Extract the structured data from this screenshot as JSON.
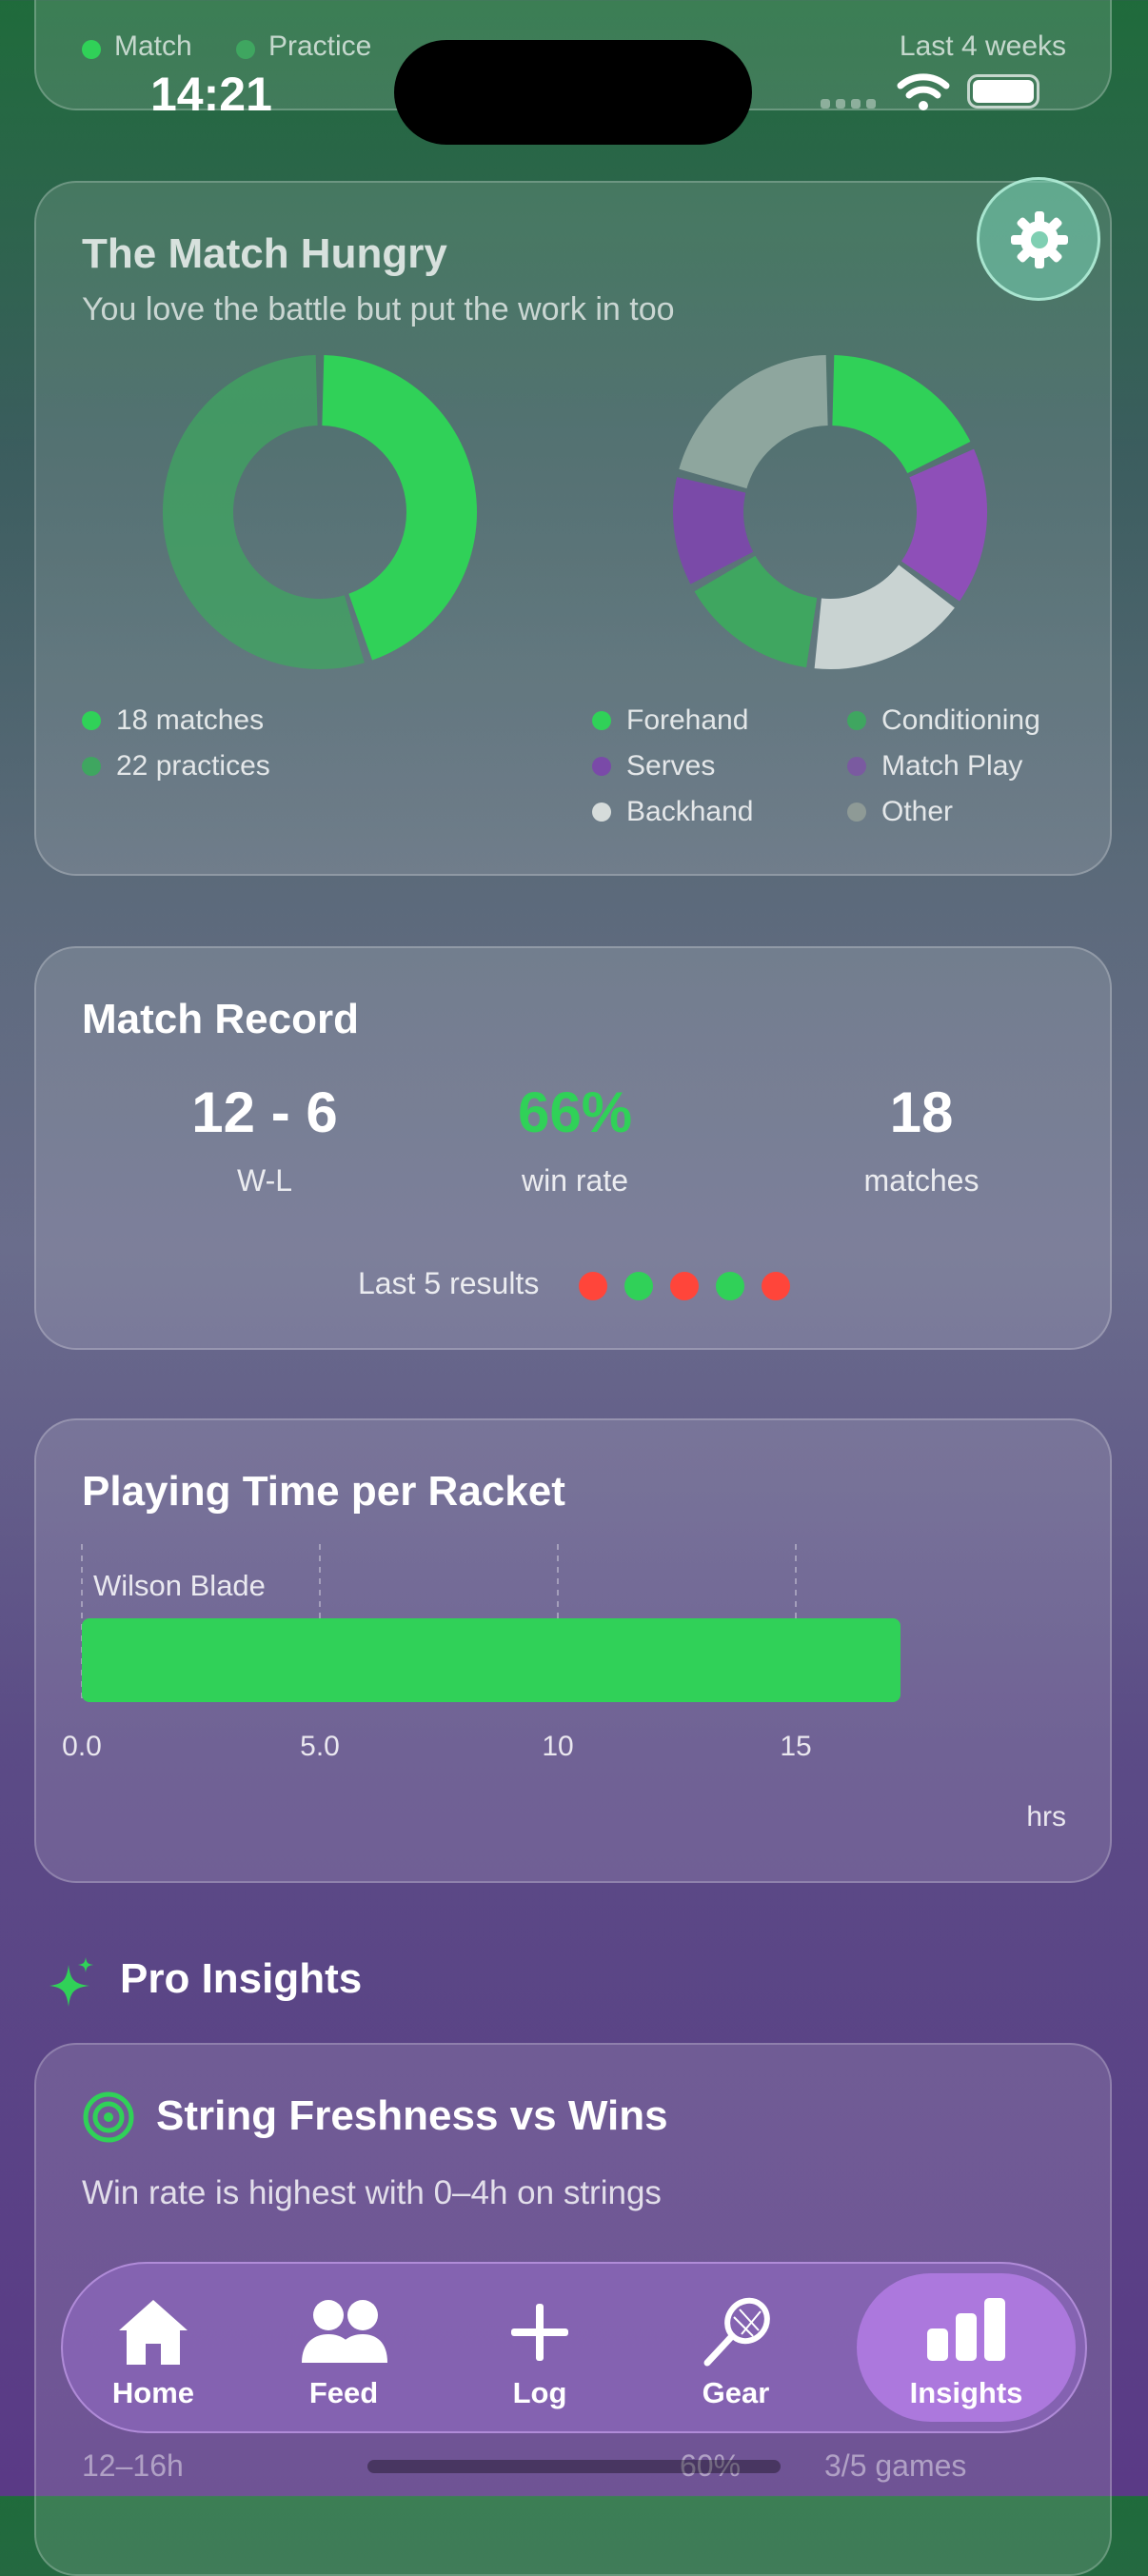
{
  "status_bar": {
    "time": "14:21"
  },
  "top_card": {
    "legend_match": "Match",
    "legend_practice": "Practice",
    "range": "Last 4 weeks"
  },
  "profile_card": {
    "title": "The Match Hungry",
    "subtitle": "You love the battle but put the work in too",
    "settings_icon": "gear-icon",
    "session_donut": {
      "matches": 18,
      "practices": 22,
      "match_color": "#30d158",
      "practice_color": "#3fa660"
    },
    "legend_left": [
      "18 matches",
      "22 practices"
    ],
    "focus_donut": {
      "segments": [
        {
          "name": "Forehand",
          "value": 0.18,
          "color": "#30d158"
        },
        {
          "name": "Match Play",
          "value": 0.17,
          "color": "#8e4fb8"
        },
        {
          "name": "Backhand",
          "value": 0.17,
          "color": "#c9d3d2"
        },
        {
          "name": "Conditioning",
          "value": 0.15,
          "color": "#3fa660"
        },
        {
          "name": "Serves",
          "value": 0.12,
          "color": "#7a4aa8"
        },
        {
          "name": "Other",
          "value": 0.21,
          "color": "#8ea69e"
        }
      ]
    },
    "legend_right": {
      "forehand": "Forehand",
      "conditioning": "Conditioning",
      "serves": "Serves",
      "match_play": "Match Play",
      "backhand": "Backhand",
      "other": "Other"
    }
  },
  "match_record": {
    "title": "Match Record",
    "wl": "12 - 6",
    "wl_label": "W-L",
    "win_rate": "66%",
    "win_rate_label": "win rate",
    "matches": "18",
    "matches_label": "matches",
    "last5_label": "Last 5 results",
    "last5": [
      "loss",
      "win",
      "loss",
      "win",
      "loss"
    ],
    "win_color": "#30d158",
    "loss_color": "#ff453a"
  },
  "racket_card": {
    "title": "Playing Time per Racket",
    "unit": "hrs",
    "chart_data": {
      "type": "bar",
      "orientation": "horizontal",
      "categories": [
        "Wilson Blade"
      ],
      "values": [
        17.2
      ],
      "xlim": [
        0,
        20
      ],
      "ticks": [
        "0.0",
        "5.0",
        "10",
        "15"
      ],
      "xlabel": "hrs",
      "bar_color": "#30d158",
      "grid": true
    }
  },
  "pro_insights": {
    "heading": "Pro Insights",
    "sparkle_icon": "sparkle-icon",
    "card_title": "String Freshness vs Wins",
    "target_icon": "target-icon",
    "card_subtitle": "Win rate is highest with 0–4h on strings",
    "peek_row": {
      "range": "12–16h",
      "pct": "60%",
      "games": "3/5 games"
    }
  },
  "nav": {
    "items": [
      {
        "label": "Home",
        "icon": "home-icon"
      },
      {
        "label": "Feed",
        "icon": "people-icon"
      },
      {
        "label": "Log",
        "icon": "plus-icon"
      },
      {
        "label": "Gear",
        "icon": "racket-icon"
      },
      {
        "label": "Insights",
        "icon": "bar-chart-icon"
      }
    ],
    "active": "Insights"
  }
}
